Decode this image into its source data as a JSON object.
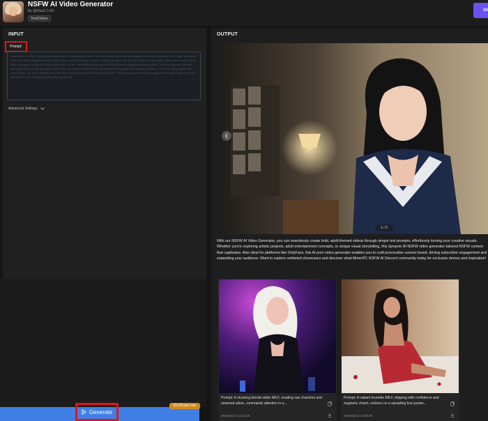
{
  "app": {
    "title": "NSFW AI Video Generator",
    "byline": "By @Wan2.1-t2v",
    "tag": "Text2Video",
    "share_label": "Sh"
  },
  "input": {
    "heading": "INPUT",
    "prompt_label": "Prompt:",
    "prompt_text": "A mid-shot of a 40s, busty Asian woman with a cute youthful charm. Her face clearly framed as she stands in a softly lit bedroom. Her fringe, sparkling eyes and playful, mischievous grin light up her smooth features. Rushed cheeks glowing under the warm light of a desk lamp. She wears a navy sailor-style schoolgirl cosplay top, snug against her curves, the neckline hinting at her chest without exposing anything explicit. The lens captures her face and upper body as she delicately loosens the top buttons of her blouse. Her fingers moving with slow teasing precision, her chest rising slightly with each breath. Her long, straight black hair falls in loose waves, brushing her shoulders. The background blurs into manga posters and a plush bed, with the faint hint of a ceiling fan drifting through the air.",
    "advanced_label": "Advanced Settings",
    "price_badge": "$ 0.50 per use",
    "generate_label": "Generate"
  },
  "output": {
    "heading": "OUTPUT",
    "page_indicator": "1 / 5",
    "description": "With our NSFW AI Video Generator, you can seamlessly create bold, adult-themed videos through simple text prompts, effortlessly turning your creative visuals. Whether you're exploring artistic projects, adult entertainment concepts, or unique visual storytelling, this dynamic AI NSFW video generator tailored NSFW content that captivates. Also ideal for platforms like OnlyFans, this AI porn video generator enables you to craft provocative scenes brand, driving subscriber engagement and expanding your audience. Want to explore unlimited showcases and discover what MimicPC NSFW AI Discord community today for exclusive demos and inspiration!",
    "cards": [
      {
        "prompt": "Prompt: A stunning blonde white MILF, exuding raw charisma and untamed allure, commands attention in a...",
        "date": "2025/04/13 13:23:20"
      },
      {
        "prompt": "Prompt: A radiant brunette MILF, dripping with confidence and magnetic charm, reclines on a sprawling four-poster...",
        "date": "2025/04/13 13:25:00"
      }
    ]
  },
  "colors": {
    "accent": "#6b50f2",
    "generate": "#3f7fe6",
    "highlight_border": "#e5121b",
    "price_badge": "#d18a1d"
  },
  "icons": {
    "chevron": "chevron-down-icon",
    "prev": "chevron-left-icon",
    "play": "play-icon",
    "copy": "copy-icon",
    "download": "download-icon"
  }
}
